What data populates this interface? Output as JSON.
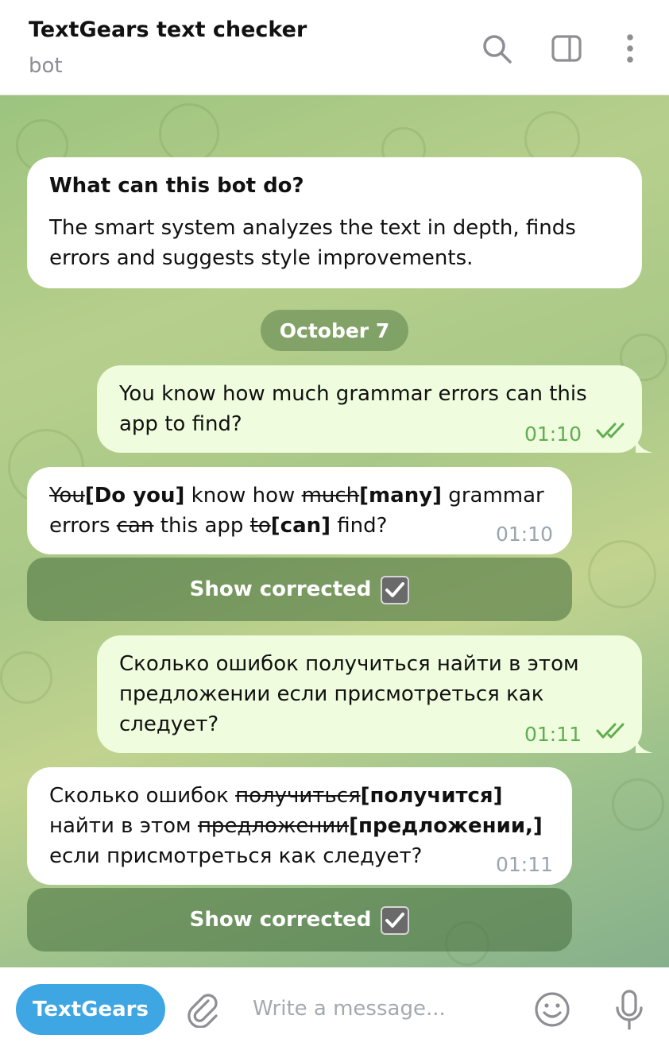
{
  "header": {
    "title": "TextGears text checker",
    "subtitle": "bot"
  },
  "intro": {
    "heading": "What can this bot do?",
    "body": "The smart system analyzes the text in depth, finds errors and suggests style improvements."
  },
  "date_pill": "October 7",
  "messages": [
    {
      "direction": "outgoing",
      "text": "You know how much grammar errors can this app to find?",
      "time": "01:10",
      "status_icon": "double-check-icon"
    },
    {
      "direction": "incoming",
      "segments": [
        {
          "text": "You",
          "style": "strike"
        },
        {
          "text": "[Do you]",
          "style": "bold"
        },
        {
          "text": " know how ",
          "style": "normal"
        },
        {
          "text": "much",
          "style": "strike"
        },
        {
          "text": "[many]",
          "style": "bold"
        },
        {
          "text": " grammar errors ",
          "style": "normal"
        },
        {
          "text": "can",
          "style": "strike"
        },
        {
          "text": " this app ",
          "style": "normal"
        },
        {
          "text": "to",
          "style": "strike"
        },
        {
          "text": "[can]",
          "style": "bold"
        },
        {
          "text": " find?",
          "style": "normal"
        }
      ],
      "time": "01:10",
      "button_label": "Show corrected",
      "button_icon": "checkbox-checked-icon"
    },
    {
      "direction": "outgoing",
      "text": "Сколько ошибок получиться найти в этом предложении если присмотреться как следует?",
      "time": "01:11",
      "status_icon": "double-check-icon"
    },
    {
      "direction": "incoming",
      "segments": [
        {
          "text": "Сколько ошибок ",
          "style": "normal"
        },
        {
          "text": "получиться",
          "style": "strike"
        },
        {
          "text": "[получится]",
          "style": "bold"
        },
        {
          "text": " найти в этом ",
          "style": "normal"
        },
        {
          "text": "предложении",
          "style": "strike"
        },
        {
          "text": "[предложении,]",
          "style": "bold"
        },
        {
          "text": " если присмотреться как следует?",
          "style": "normal"
        }
      ],
      "time": "01:11",
      "button_label": "Show corrected",
      "button_icon": "checkbox-checked-icon"
    }
  ],
  "composer": {
    "bot_button": "TextGears",
    "placeholder": "Write a message..."
  },
  "colors": {
    "accent": "#3ea6e3",
    "outgoing_bubble": "#effdde",
    "read_tick": "#5fae4e"
  }
}
